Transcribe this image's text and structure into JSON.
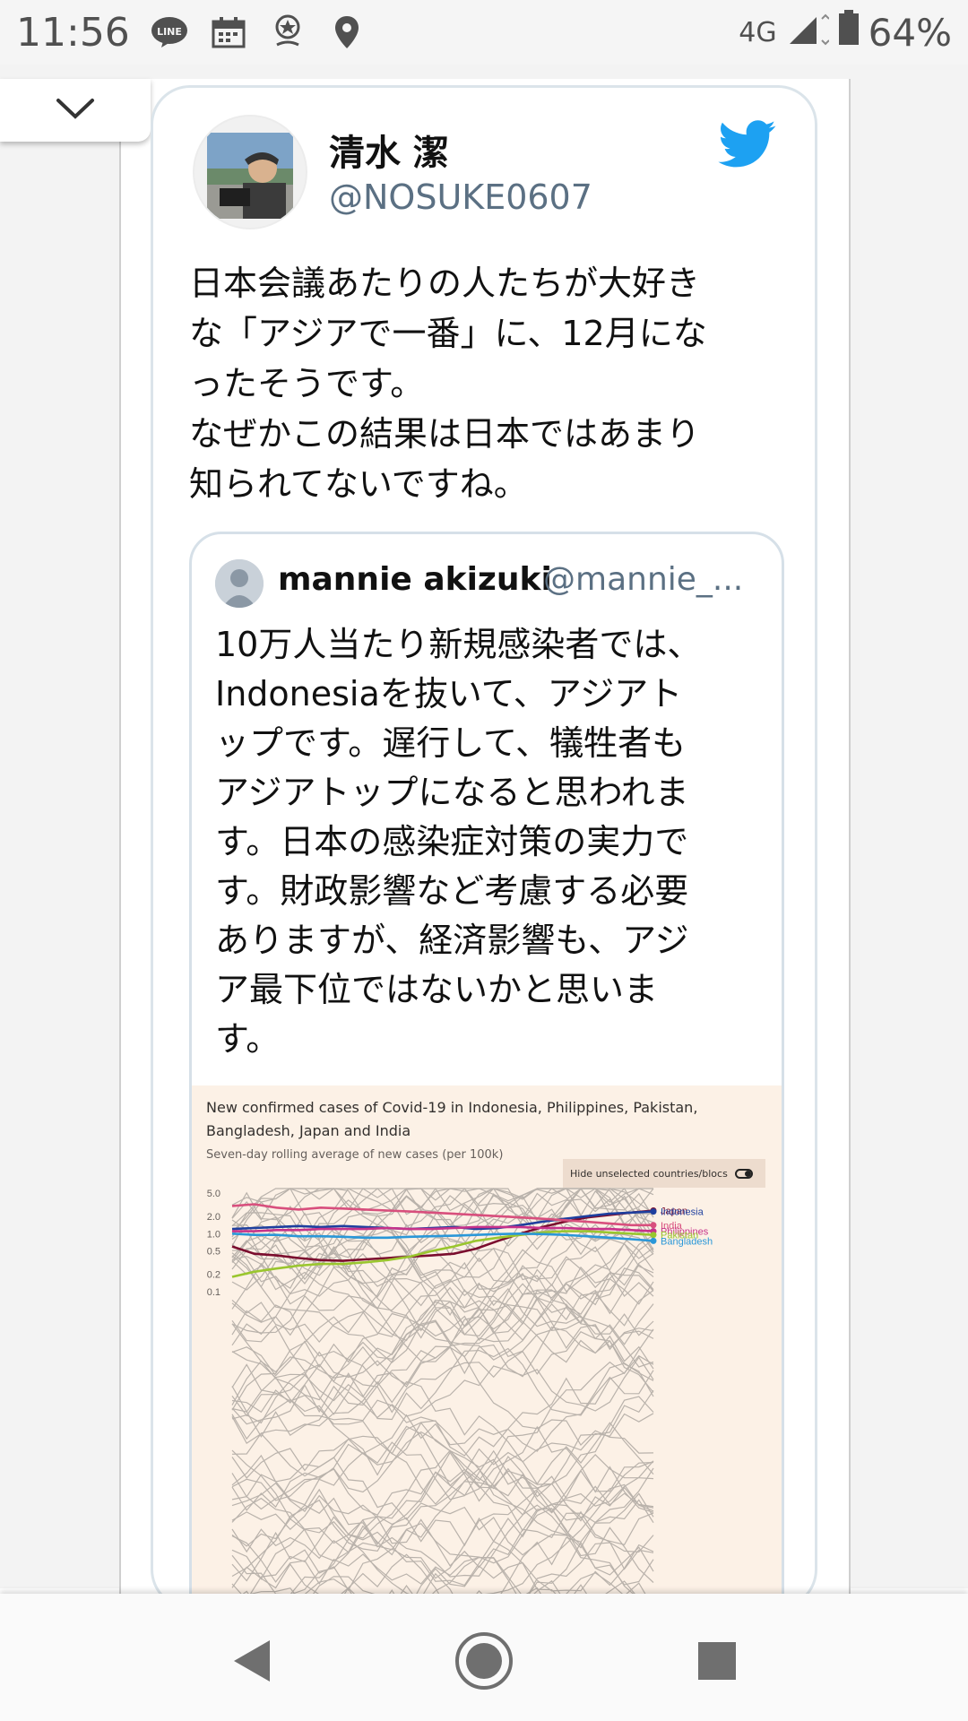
{
  "status_bar": {
    "time": "11:56",
    "network": "4G",
    "battery": "64%",
    "icons": [
      "line-icon",
      "calendar-icon",
      "badge-icon",
      "location-icon",
      "signal-icon",
      "battery-icon"
    ]
  },
  "tweet": {
    "author_name": "清水 潔",
    "author_handle": "@NOSUKE0607",
    "text": "日本会議あたりの人たちが大好き\nな「アジアで一番」に、12月にな\nったそうです。\nなぜかこの結果は日本ではあまり\n知られてないですね。",
    "brand_color": "#1da1f2"
  },
  "quoted_tweet": {
    "author_name": "mannie akizuki",
    "author_handle": "@mannie_...",
    "text": "10万人当たり新規感染者では、\nIndonesiaを抜いて、アジアト\nップです。遅行して、犠牲者も\nアジアトップになると思われま\nす。日本の感染症対策の実力で\nす。財政影響など考慮する必要\nありますが、経済影響も、アジ\nア最下位ではないかと思いま\nす。"
  },
  "chart_data": {
    "type": "line",
    "title": "New confirmed cases of Covid-19 in Indonesia, Philippines, Pakistan, Bangladesh, Japan and India",
    "subtitle": "Seven-day rolling average of new cases (per 100k)",
    "toggle_label": "Hide unselected countries/blocs",
    "y_scale": "log",
    "y_ticks": [
      "5.0",
      "2.0",
      "1.0",
      "0.5",
      "0.2",
      "0.1"
    ],
    "ylim": [
      0.1,
      5.0
    ],
    "x_points": 20,
    "series": [
      {
        "name": "Japan",
        "color": "#7b0d2e",
        "values": [
          0.6,
          0.45,
          0.42,
          0.38,
          0.35,
          0.34,
          0.36,
          0.38,
          0.4,
          0.42,
          0.45,
          0.55,
          0.75,
          1.0,
          1.3,
          1.6,
          1.9,
          2.1,
          2.3,
          2.5
        ]
      },
      {
        "name": "Indonesia",
        "color": "#1e3f9e",
        "values": [
          1.2,
          1.25,
          1.3,
          1.35,
          1.3,
          1.35,
          1.3,
          1.25,
          1.2,
          1.25,
          1.3,
          1.2,
          1.25,
          1.4,
          1.6,
          1.8,
          2.0,
          2.2,
          2.3,
          2.4
        ]
      },
      {
        "name": "India",
        "color": "#d84f7d",
        "values": [
          3.0,
          3.2,
          2.8,
          2.6,
          2.8,
          2.7,
          2.6,
          2.5,
          2.4,
          2.3,
          2.2,
          2.1,
          2.0,
          1.9,
          1.8,
          1.7,
          1.6,
          1.5,
          1.4,
          1.4
        ]
      },
      {
        "name": "Philippines",
        "color": "#c7328a",
        "values": [
          1.1,
          1.1,
          1.15,
          1.15,
          1.2,
          1.2,
          1.2,
          1.25,
          1.2,
          1.2,
          1.25,
          1.3,
          1.3,
          1.3,
          1.25,
          1.25,
          1.2,
          1.2,
          1.15,
          1.1
        ]
      },
      {
        "name": "Pakistan",
        "color": "#9ac62e",
        "values": [
          0.18,
          0.22,
          0.25,
          0.28,
          0.3,
          0.3,
          0.32,
          0.35,
          0.4,
          0.5,
          0.6,
          0.75,
          0.85,
          0.95,
          1.05,
          1.1,
          1.1,
          1.05,
          1.0,
          0.95
        ]
      },
      {
        "name": "Bangladesh",
        "color": "#2a97d8",
        "values": [
          1.0,
          0.95,
          0.95,
          0.9,
          0.9,
          0.88,
          0.85,
          0.85,
          0.88,
          0.9,
          0.92,
          0.95,
          0.98,
          1.0,
          0.98,
          0.95,
          0.9,
          0.85,
          0.8,
          0.75
        ]
      }
    ],
    "legend_labels": [
      "Japan",
      "Indonesia",
      "India",
      "Philippines",
      "Pakistan",
      "Bangladesh"
    ]
  }
}
